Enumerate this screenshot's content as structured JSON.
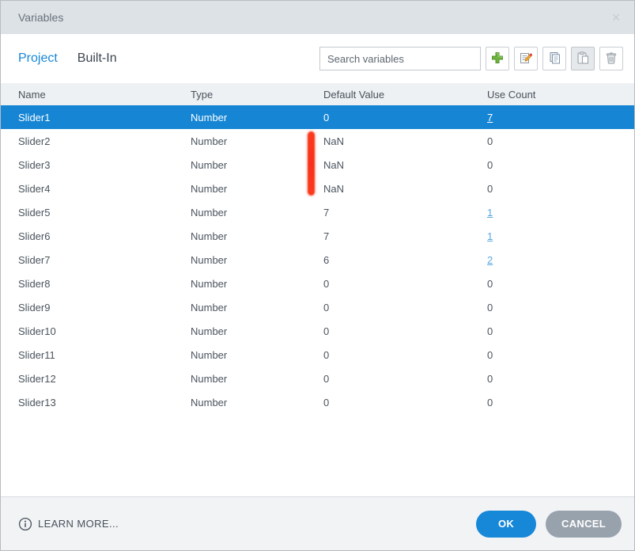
{
  "dialog": {
    "title": "Variables",
    "close_glyph": "✕"
  },
  "tabs": [
    {
      "label": "Project",
      "active": true
    },
    {
      "label": "Built-In",
      "active": false
    }
  ],
  "search": {
    "placeholder": "Search variables"
  },
  "toolbar": {
    "icons": [
      "add-variable",
      "edit-variable",
      "copy-variable",
      "paste-variable",
      "delete-variable"
    ],
    "paste_pressed": true
  },
  "table": {
    "headers": [
      "Name",
      "Type",
      "Default Value",
      "Use Count"
    ],
    "rows": [
      {
        "name": "Slider1",
        "type": "Number",
        "default": "0",
        "use_count": "7",
        "use_count_link": true,
        "selected": true
      },
      {
        "name": "Slider2",
        "type": "Number",
        "default": "NaN",
        "use_count": "0",
        "use_count_link": false,
        "selected": false
      },
      {
        "name": "Slider3",
        "type": "Number",
        "default": "NaN",
        "use_count": "0",
        "use_count_link": false,
        "selected": false
      },
      {
        "name": "Slider4",
        "type": "Number",
        "default": "NaN",
        "use_count": "0",
        "use_count_link": false,
        "selected": false
      },
      {
        "name": "Slider5",
        "type": "Number",
        "default": "7",
        "use_count": "1",
        "use_count_link": true,
        "selected": false
      },
      {
        "name": "Slider6",
        "type": "Number",
        "default": "7",
        "use_count": "1",
        "use_count_link": true,
        "selected": false
      },
      {
        "name": "Slider7",
        "type": "Number",
        "default": "6",
        "use_count": "2",
        "use_count_link": true,
        "selected": false
      },
      {
        "name": "Slider8",
        "type": "Number",
        "default": "0",
        "use_count": "0",
        "use_count_link": false,
        "selected": false
      },
      {
        "name": "Slider9",
        "type": "Number",
        "default": "0",
        "use_count": "0",
        "use_count_link": false,
        "selected": false
      },
      {
        "name": "Slider10",
        "type": "Number",
        "default": "0",
        "use_count": "0",
        "use_count_link": false,
        "selected": false
      },
      {
        "name": "Slider11",
        "type": "Number",
        "default": "0",
        "use_count": "0",
        "use_count_link": false,
        "selected": false
      },
      {
        "name": "Slider12",
        "type": "Number",
        "default": "0",
        "use_count": "0",
        "use_count_link": false,
        "selected": false
      },
      {
        "name": "Slider13",
        "type": "Number",
        "default": "0",
        "use_count": "0",
        "use_count_link": false,
        "selected": false
      }
    ]
  },
  "annotation": {
    "type": "red-marker-bar",
    "color": "#fb3a1b",
    "highlights_rows": [
      "Slider2",
      "Slider3",
      "Slider4"
    ]
  },
  "footer": {
    "learn_more_label": "LEARN MORE...",
    "ok_label": "OK",
    "cancel_label": "CANCEL"
  },
  "colors": {
    "accent_blue": "#1787d8",
    "selected_row": "#1585d4",
    "link_blue": "#58a8de",
    "titlebar_bg": "#dde2e6",
    "header_bg": "#eef1f3",
    "footer_bg": "#f1f3f5",
    "cancel_gray": "#98a2ac",
    "annotation_red": "#fb3a1b",
    "add_green": "#6db33f"
  }
}
